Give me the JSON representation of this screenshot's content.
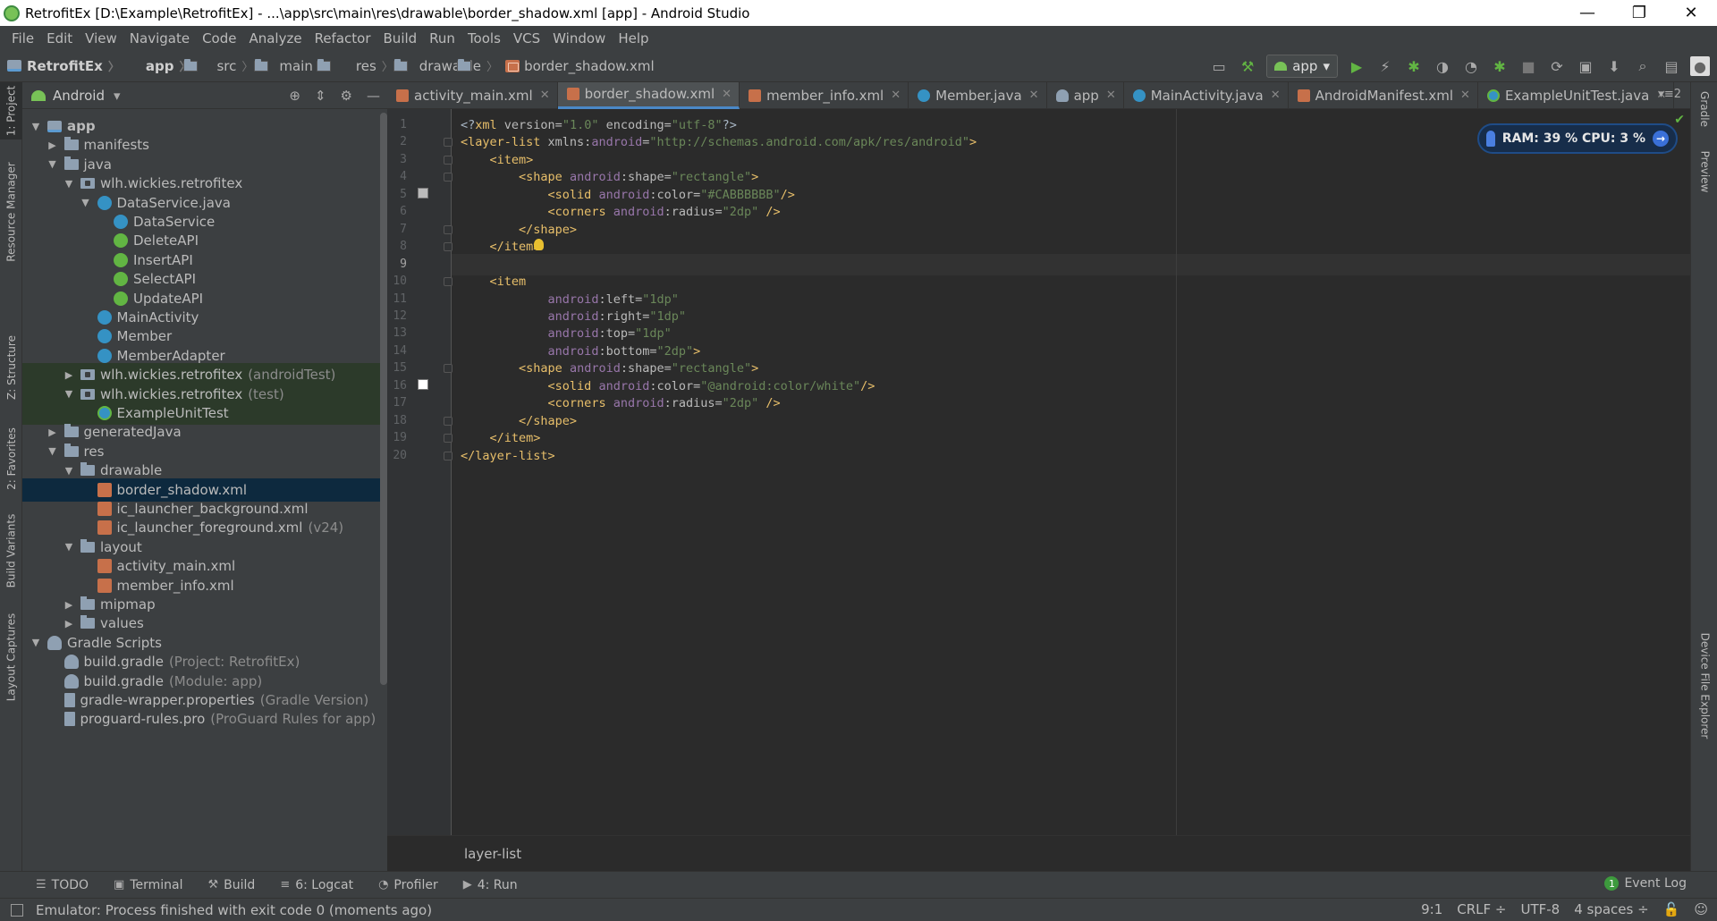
{
  "window": {
    "title": "RetrofitEx [D:\\Example\\RetrofitEx] - ...\\app\\src\\main\\res\\drawable\\border_shadow.xml [app] - Android Studio",
    "minimize": "—",
    "restore": "❐",
    "close": "✕"
  },
  "menu": [
    "File",
    "Edit",
    "View",
    "Navigate",
    "Code",
    "Analyze",
    "Refactor",
    "Build",
    "Run",
    "Tools",
    "VCS",
    "Window",
    "Help"
  ],
  "breadcrumb": [
    "RetrofitEx",
    "app",
    "src",
    "main",
    "res",
    "drawable",
    "border_shadow.xml"
  ],
  "run_config": "app",
  "project_panel": {
    "view": "Android"
  },
  "tree": [
    {
      "label": "app",
      "depth": 0,
      "arrow": "▼",
      "icon": "appmod",
      "hint": "",
      "bold": true
    },
    {
      "label": "manifests",
      "depth": 1,
      "arrow": "▶",
      "icon": "folder",
      "hint": ""
    },
    {
      "label": "java",
      "depth": 1,
      "arrow": "▼",
      "icon": "folder",
      "hint": ""
    },
    {
      "label": "wlh.wickies.retrofitex",
      "depth": 2,
      "arrow": "▼",
      "icon": "pkg",
      "hint": ""
    },
    {
      "label": "DataService.java",
      "depth": 3,
      "arrow": "▼",
      "icon": "cls",
      "hint": ""
    },
    {
      "label": "DataService",
      "depth": 4,
      "arrow": "",
      "icon": "cls",
      "hint": ""
    },
    {
      "label": "DeleteAPI",
      "depth": 4,
      "arrow": "",
      "icon": "iface",
      "hint": ""
    },
    {
      "label": "InsertAPI",
      "depth": 4,
      "arrow": "",
      "icon": "iface",
      "hint": ""
    },
    {
      "label": "SelectAPI",
      "depth": 4,
      "arrow": "",
      "icon": "iface",
      "hint": ""
    },
    {
      "label": "UpdateAPI",
      "depth": 4,
      "arrow": "",
      "icon": "iface",
      "hint": ""
    },
    {
      "label": "MainActivity",
      "depth": 3,
      "arrow": "",
      "icon": "cls",
      "hint": ""
    },
    {
      "label": "Member",
      "depth": 3,
      "arrow": "",
      "icon": "cls",
      "hint": ""
    },
    {
      "label": "MemberAdapter",
      "depth": 3,
      "arrow": "",
      "icon": "cls",
      "hint": ""
    },
    {
      "label": "wlh.wickies.retrofitex",
      "depth": 2,
      "arrow": "▶",
      "icon": "pkg",
      "hint": "(androidTest)",
      "test": true
    },
    {
      "label": "wlh.wickies.retrofitex",
      "depth": 2,
      "arrow": "▼",
      "icon": "pkg",
      "hint": "(test)",
      "test": true
    },
    {
      "label": "ExampleUnitTest",
      "depth": 3,
      "arrow": "",
      "icon": "test",
      "hint": "",
      "test": true
    },
    {
      "label": "generatedJava",
      "depth": 1,
      "arrow": "▶",
      "icon": "folder",
      "hint": ""
    },
    {
      "label": "res",
      "depth": 1,
      "arrow": "▼",
      "icon": "folder",
      "hint": ""
    },
    {
      "label": "drawable",
      "depth": 2,
      "arrow": "▼",
      "icon": "folder",
      "hint": ""
    },
    {
      "label": "border_shadow.xml",
      "depth": 3,
      "arrow": "",
      "icon": "xml",
      "hint": "",
      "selected": true
    },
    {
      "label": "ic_launcher_background.xml",
      "depth": 3,
      "arrow": "",
      "icon": "xml",
      "hint": ""
    },
    {
      "label": "ic_launcher_foreground.xml",
      "depth": 3,
      "arrow": "",
      "icon": "xml",
      "hint": "(v24)"
    },
    {
      "label": "layout",
      "depth": 2,
      "arrow": "▼",
      "icon": "folder",
      "hint": ""
    },
    {
      "label": "activity_main.xml",
      "depth": 3,
      "arrow": "",
      "icon": "xml",
      "hint": ""
    },
    {
      "label": "member_info.xml",
      "depth": 3,
      "arrow": "",
      "icon": "xml",
      "hint": ""
    },
    {
      "label": "mipmap",
      "depth": 2,
      "arrow": "▶",
      "icon": "folder",
      "hint": ""
    },
    {
      "label": "values",
      "depth": 2,
      "arrow": "▶",
      "icon": "folder",
      "hint": ""
    },
    {
      "label": "Gradle Scripts",
      "depth": 0,
      "arrow": "▼",
      "icon": "gradle",
      "hint": ""
    },
    {
      "label": "build.gradle",
      "depth": 1,
      "arrow": "",
      "icon": "gradle",
      "hint": "(Project: RetrofitEx)"
    },
    {
      "label": "build.gradle",
      "depth": 1,
      "arrow": "",
      "icon": "gradle",
      "hint": "(Module: app)"
    },
    {
      "label": "gradle-wrapper.properties",
      "depth": 1,
      "arrow": "",
      "icon": "file",
      "hint": "(Gradle Version)"
    },
    {
      "label": "proguard-rules.pro",
      "depth": 1,
      "arrow": "",
      "icon": "file",
      "hint": "(ProGuard Rules for app)"
    }
  ],
  "tabs": [
    {
      "label": "activity_main.xml",
      "icon": "xml",
      "active": false
    },
    {
      "label": "border_shadow.xml",
      "icon": "xml",
      "active": true
    },
    {
      "label": "member_info.xml",
      "icon": "xml",
      "active": false
    },
    {
      "label": "Member.java",
      "icon": "cls",
      "active": false
    },
    {
      "label": "app",
      "icon": "gradle",
      "active": false
    },
    {
      "label": "MainActivity.java",
      "icon": "cls",
      "active": false
    },
    {
      "label": "AndroidManifest.xml",
      "icon": "xml",
      "active": false
    },
    {
      "label": "ExampleUnitTest.java",
      "icon": "test",
      "active": false
    }
  ],
  "tabs_more": "▾≡2",
  "code_lines": [
    [
      [
        "pl",
        "<?"
      ],
      [
        "tg",
        "xml "
      ],
      [
        "at",
        "version="
      ],
      [
        "sv",
        "\"1.0\""
      ],
      [
        "at",
        " encoding="
      ],
      [
        "sv",
        "\"utf-8\""
      ],
      [
        "pl",
        "?>"
      ]
    ],
    [
      [
        "tg",
        "<layer-list "
      ],
      [
        "at",
        "xmlns:"
      ],
      [
        "ns",
        "android"
      ],
      [
        "at",
        "="
      ],
      [
        "sv",
        "\"http://schemas.android.com/apk/res/android\""
      ],
      [
        "tg",
        ">"
      ]
    ],
    [
      [
        "pl",
        "    "
      ],
      [
        "tg",
        "<item>"
      ]
    ],
    [
      [
        "pl",
        "        "
      ],
      [
        "tg",
        "<shape "
      ],
      [
        "ns",
        "android"
      ],
      [
        "at",
        ":shape="
      ],
      [
        "sv",
        "\"rectangle\""
      ],
      [
        "tg",
        ">"
      ]
    ],
    [
      [
        "pl",
        "            "
      ],
      [
        "tg",
        "<solid "
      ],
      [
        "ns",
        "android"
      ],
      [
        "at",
        ":color="
      ],
      [
        "sv",
        "\"#CABBBBBB\""
      ],
      [
        "tg",
        "/>"
      ]
    ],
    [
      [
        "pl",
        "            "
      ],
      [
        "tg",
        "<corners "
      ],
      [
        "ns",
        "android"
      ],
      [
        "at",
        ":radius="
      ],
      [
        "sv",
        "\"2dp\""
      ],
      [
        "tg",
        " />"
      ]
    ],
    [
      [
        "pl",
        "        "
      ],
      [
        "tg",
        "</shape>"
      ]
    ],
    [
      [
        "pl",
        "    "
      ],
      [
        "tg",
        "</item>"
      ]
    ],
    [
      [
        "pl",
        ""
      ]
    ],
    [
      [
        "pl",
        "    "
      ],
      [
        "tg",
        "<item"
      ]
    ],
    [
      [
        "pl",
        "            "
      ],
      [
        "ns",
        "android"
      ],
      [
        "at",
        ":left="
      ],
      [
        "sv",
        "\"1dp\""
      ]
    ],
    [
      [
        "pl",
        "            "
      ],
      [
        "ns",
        "android"
      ],
      [
        "at",
        ":right="
      ],
      [
        "sv",
        "\"1dp\""
      ]
    ],
    [
      [
        "pl",
        "            "
      ],
      [
        "ns",
        "android"
      ],
      [
        "at",
        ":top="
      ],
      [
        "sv",
        "\"1dp\""
      ]
    ],
    [
      [
        "pl",
        "            "
      ],
      [
        "ns",
        "android"
      ],
      [
        "at",
        ":bottom="
      ],
      [
        "sv",
        "\"2dp\""
      ],
      [
        "tg",
        ">"
      ]
    ],
    [
      [
        "pl",
        "        "
      ],
      [
        "tg",
        "<shape "
      ],
      [
        "ns",
        "android"
      ],
      [
        "at",
        ":shape="
      ],
      [
        "sv",
        "\"rectangle\""
      ],
      [
        "tg",
        ">"
      ]
    ],
    [
      [
        "pl",
        "            "
      ],
      [
        "tg",
        "<solid "
      ],
      [
        "ns",
        "android"
      ],
      [
        "at",
        ":color="
      ],
      [
        "sv",
        "\"@android:color/white\""
      ],
      [
        "tg",
        "/>"
      ]
    ],
    [
      [
        "pl",
        "            "
      ],
      [
        "tg",
        "<corners "
      ],
      [
        "ns",
        "android"
      ],
      [
        "at",
        ":radius="
      ],
      [
        "sv",
        "\"2dp\""
      ],
      [
        "tg",
        " />"
      ]
    ],
    [
      [
        "pl",
        "        "
      ],
      [
        "tg",
        "</shape>"
      ]
    ],
    [
      [
        "pl",
        "    "
      ],
      [
        "tg",
        "</item>"
      ]
    ],
    [
      [
        "tg",
        "</layer-list>"
      ]
    ]
  ],
  "editor_breadcrumb": "layer-list",
  "memory": {
    "text": "RAM: 39 %  CPU: 3 %"
  },
  "left_tabs": [
    "1: Project",
    "Resource Manager",
    "Z: Structure",
    "2: Favorites",
    "Build Variants",
    "Layout Captures"
  ],
  "right_tabs": [
    "Gradle",
    "Preview",
    "Device File Explorer"
  ],
  "tool_windows": [
    "TODO",
    "Terminal",
    "Build",
    "6: Logcat",
    "Profiler",
    "4: Run"
  ],
  "event_log": {
    "label": "Event Log",
    "count": "1"
  },
  "status": {
    "message": "Emulator: Process finished with exit code 0 (moments ago)",
    "position": "9:1",
    "line_sep": "CRLF ÷",
    "encoding": "UTF-8",
    "indent": "4 spaces ÷"
  },
  "colors": {
    "accent": "#4a88c7",
    "selection": "#0d293e",
    "test_bg": "#2c3a2a"
  }
}
